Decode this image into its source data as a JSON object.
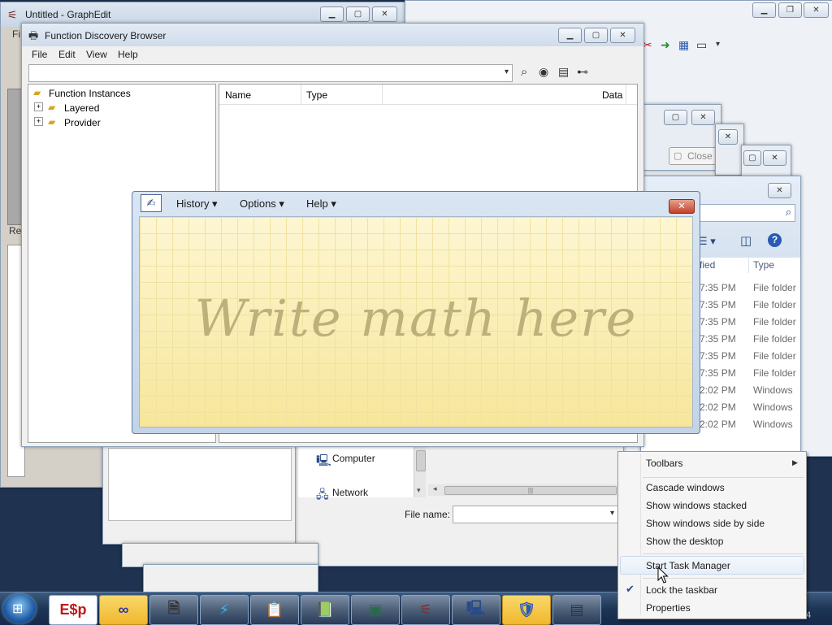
{
  "graphedit": {
    "title": "Untitled - GraphEdit",
    "menu_letter": "Fi",
    "status_fragment": "Re"
  },
  "function_discovery": {
    "title": "Function Discovery Browser",
    "menu": [
      "File",
      "Edit",
      "View",
      "Help"
    ],
    "tree_root": "Function Instances",
    "tree_children": [
      "Layered",
      "Provider"
    ],
    "columns": [
      "Name",
      "Type",
      "Data"
    ]
  },
  "math_panel": {
    "menu": [
      "History ▾",
      "Options ▾",
      "Help ▾"
    ],
    "hint": "Write math here"
  },
  "dialog_behind": {
    "close_label": "Close"
  },
  "explorer": {
    "col_modified_fragment": "fied",
    "col_type": "Type",
    "rows": [
      {
        "time": "7:35 PM",
        "type": "File folder"
      },
      {
        "time": "7:35 PM",
        "type": "File folder"
      },
      {
        "time": "7:35 PM",
        "type": "File folder"
      },
      {
        "time": "7:35 PM",
        "type": "File folder"
      },
      {
        "time": "7:35 PM",
        "type": "File folder"
      },
      {
        "time": "7:35 PM",
        "type": "File folder"
      },
      {
        "time": "2:02 PM",
        "type": "Windows"
      },
      {
        "time": "2:02 PM",
        "type": "Windows"
      },
      {
        "time": "2:02 PM",
        "type": "Windows"
      }
    ]
  },
  "save_dialog": {
    "nav": [
      "Computer",
      "Network"
    ],
    "file_name_label": "File name:"
  },
  "context_menu": {
    "items": [
      "Toolbars",
      "Cascade windows",
      "Show windows stacked",
      "Show windows side by side",
      "Show the desktop",
      "Start Task Manager",
      "Lock the taskbar",
      "Properties"
    ]
  },
  "taskbar": {
    "clock_fragment": "4"
  },
  "colors": {
    "accent": "#f0b72c",
    "desktop": "#1f3250"
  }
}
